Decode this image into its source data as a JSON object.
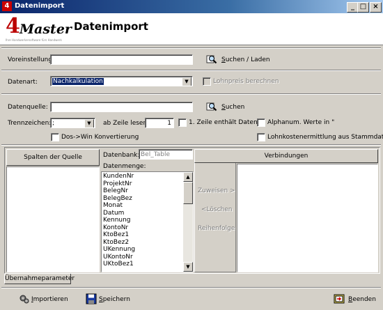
{
  "window": {
    "title": "Datenimport",
    "app_icon": "4",
    "minimize": "_",
    "maximize": "□",
    "close": "×"
  },
  "header": {
    "logo_digit": "4",
    "logo_word": "Master",
    "logo_tagline": "Ihre Handwerkersoftware fürs Handwerk",
    "title": "Datenimport"
  },
  "preset": {
    "label": "Voreinstellung:",
    "value": "",
    "button": "Suchen / Laden",
    "button_key": "S",
    "button_rest": "uchen / Laden"
  },
  "datatype": {
    "label": "Datenart:",
    "value": "Nachkalkulation",
    "wage_check_label": "Lohnpreis berechnen"
  },
  "source": {
    "label": "Datenquelle:",
    "value": "",
    "button_key": "S",
    "button_rest": "uchen",
    "separator_label": "Trennzeichen:",
    "separator_value": ";",
    "from_row_label": "ab Zeile lesen:",
    "from_row_value": "1",
    "first_row_label": "1. Zeile enthält Daten",
    "alphanum_label": "Alphanum. Werte in \"",
    "doswin_label": "Dos->Win Konvertierung",
    "wagecost_label": "Lohnkostenermittlung aus Stammdaten"
  },
  "mapping": {
    "source_columns_header": "Spalten der Quelle",
    "database_label": "Datenbank:",
    "database_value": "Bel_Table",
    "dataset_label": "Datenmenge:",
    "fields": [
      "KundenNr",
      "ProjektNr",
      "BelegNr",
      "BelegBez",
      "Monat",
      "Datum",
      "Kennung",
      "KontoNr",
      "KtoBez1",
      "KtoBez2",
      "UKennung",
      "UKontoNr",
      "UKtoBez1"
    ],
    "assign_button": "Zuweisen >",
    "delete_button": "<Löschen",
    "order_button": "Reihenfolge",
    "connections_header": "Verbindungen"
  },
  "tabs": [
    "Übernahmeparameter"
  ],
  "toolbar": {
    "import_key": "I",
    "import_rest": "mportieren",
    "save_key": "S",
    "save_rest": "peichern",
    "exit_key": "B",
    "exit_rest": "eenden"
  }
}
